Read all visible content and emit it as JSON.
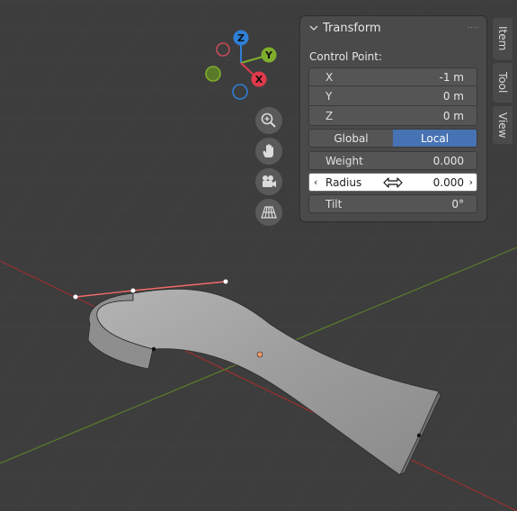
{
  "gizmo": {
    "axes": [
      {
        "name": "Z",
        "color": "#2e7fd8"
      },
      {
        "name": "Y",
        "color": "#7fae2c"
      },
      {
        "name": "X",
        "color": "#e13a4c"
      }
    ],
    "icons": [
      "zoom-icon",
      "hand-pan-icon",
      "camera-icon",
      "perspective-grid-icon"
    ]
  },
  "panel": {
    "title": "Transform",
    "section_label": "Control Point:",
    "fields": [
      {
        "label": "X",
        "value": "-1 m"
      },
      {
        "label": "Y",
        "value": "0 m"
      },
      {
        "label": "Z",
        "value": "0 m"
      }
    ],
    "space": {
      "global": "Global",
      "local": "Local",
      "selected": "Local"
    },
    "weight": {
      "label": "Weight",
      "value": "0.000"
    },
    "radius": {
      "label": "Radius",
      "value": "0.000",
      "left_arrow": "‹",
      "right_arrow": "›"
    },
    "tilt": {
      "label": "Tilt",
      "value": "0°"
    }
  },
  "sidebar_tabs": [
    "Item",
    "Tool",
    "View"
  ],
  "colors": {
    "x_axis_line": "#9a2f2f",
    "y_axis_line": "#5a7d2a",
    "active_toggle": "#4772b3",
    "control_handle": "#f09a6a",
    "curve_surface": "#9a9a9a"
  }
}
